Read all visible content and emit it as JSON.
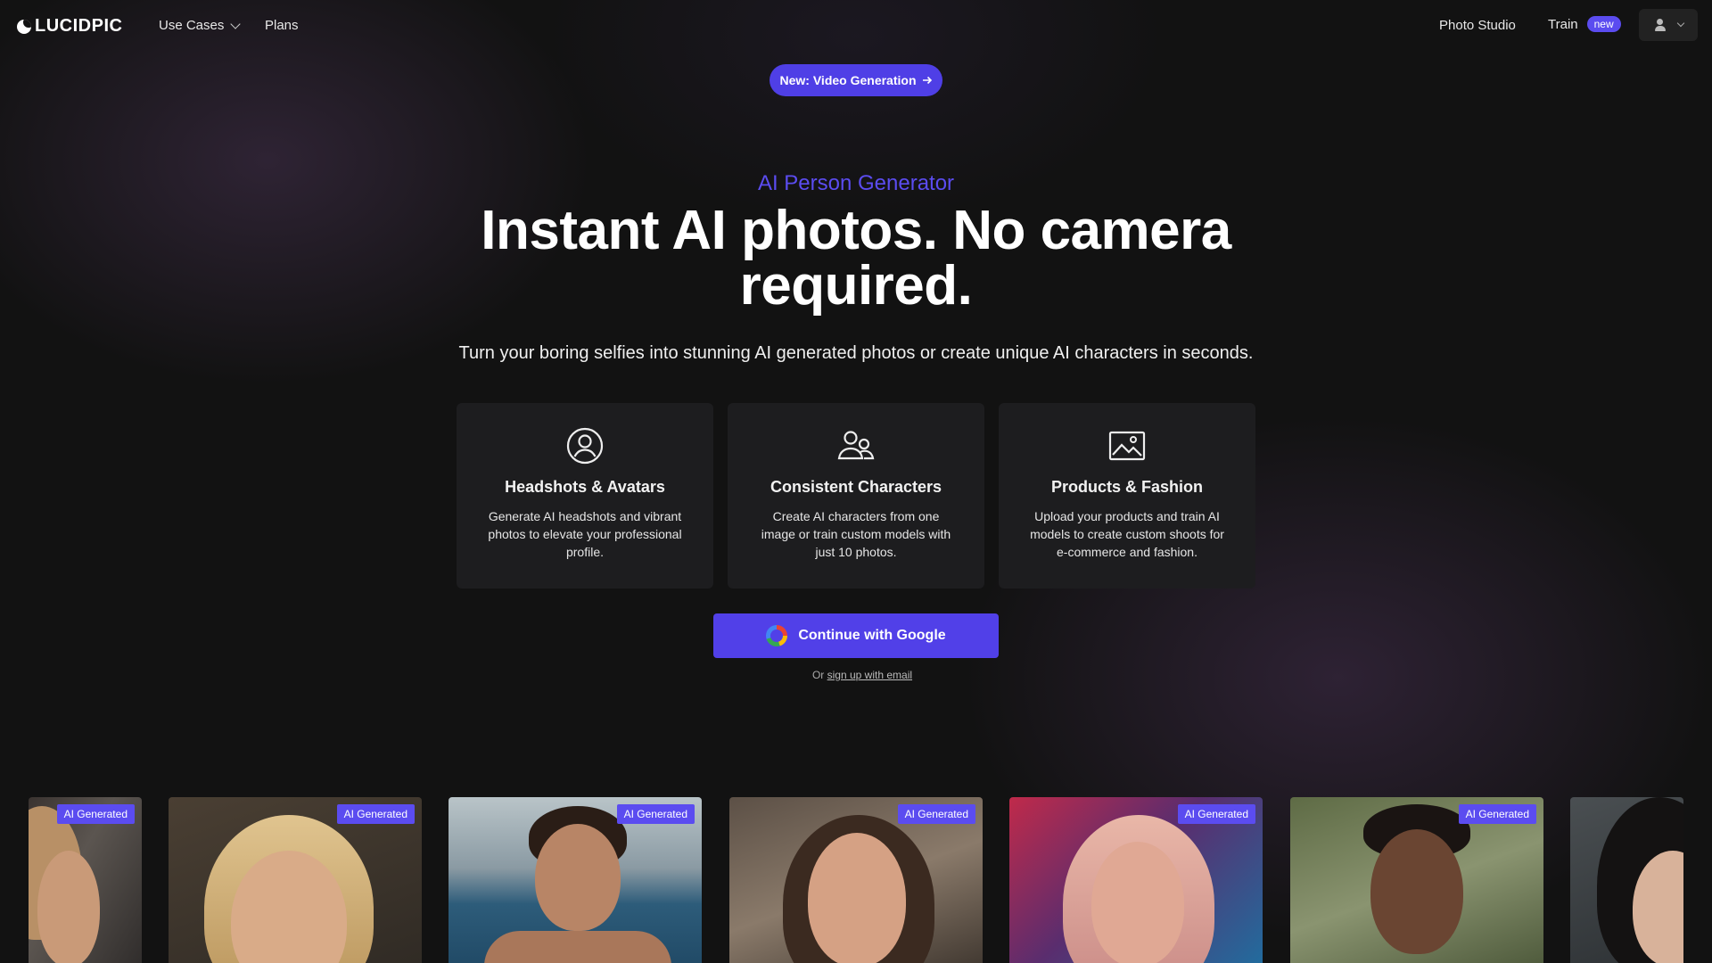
{
  "nav": {
    "logo": "LUCIDPIC",
    "items": [
      "Use Cases",
      "Plans"
    ],
    "right": {
      "photo_studio": "Photo Studio",
      "train": "Train",
      "train_badge": "new"
    }
  },
  "hero": {
    "announcement": "New: Video Generation",
    "eyebrow": "AI Person Generator",
    "title": "Instant AI photos. No camera required.",
    "subtitle": "Turn your boring selfies into stunning AI generated photos or create unique AI characters in seconds."
  },
  "cards": [
    {
      "icon": "user-circle-icon",
      "title": "Headshots & Avatars",
      "desc": "Generate AI headshots and vibrant photos to elevate your professional profile."
    },
    {
      "icon": "users-icon",
      "title": "Consistent Characters",
      "desc": "Create AI characters from one image or train custom models with just 10 photos."
    },
    {
      "icon": "image-icon",
      "title": "Products & Fashion",
      "desc": "Upload your products and train AI models to create custom shoots for e-commerce and fashion."
    }
  ],
  "cta": {
    "google": "Continue with Google",
    "alt_prefix": "Or",
    "alt_link": "sign up with email"
  },
  "gallery": {
    "tag": "AI Generated"
  },
  "colors": {
    "accent": "#5140e8",
    "background": "#121212",
    "card": "#1d1d1f"
  }
}
